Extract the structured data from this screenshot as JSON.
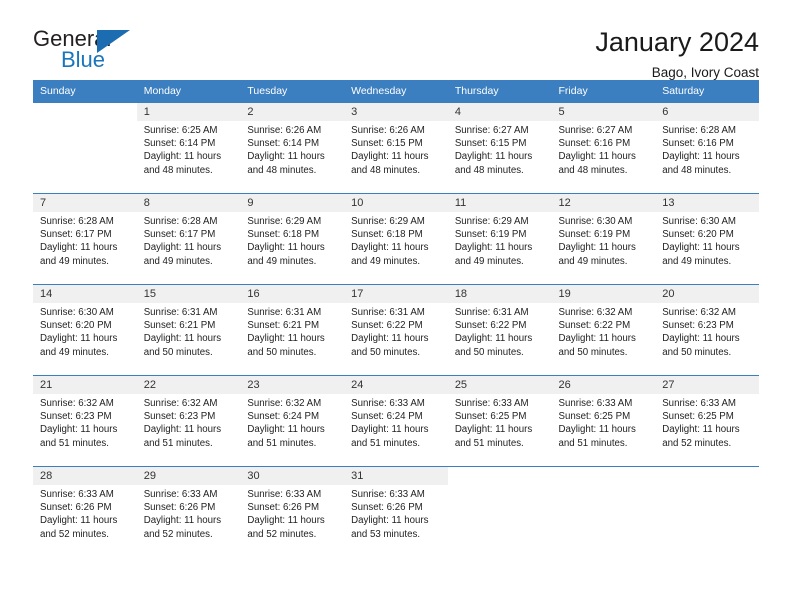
{
  "brand": {
    "name_top": "General",
    "name_bottom": "Blue",
    "accent_color": "#1b75bb",
    "triangle_color": "#1b6cb0"
  },
  "header": {
    "title": "January 2024",
    "subtitle": "Bago, Ivory Coast"
  },
  "calendar": {
    "header_bg": "#3c7fc1",
    "daynum_bg": "#f0f0f0",
    "weekday_headers": [
      "Sunday",
      "Monday",
      "Tuesday",
      "Wednesday",
      "Thursday",
      "Friday",
      "Saturday"
    ],
    "weeks": [
      [
        {
          "day": "",
          "sunrise": "",
          "sunset": "",
          "daylight_line1": "",
          "daylight_line2": ""
        },
        {
          "day": "1",
          "sunrise": "Sunrise: 6:25 AM",
          "sunset": "Sunset: 6:14 PM",
          "daylight_line1": "Daylight: 11 hours",
          "daylight_line2": "and 48 minutes."
        },
        {
          "day": "2",
          "sunrise": "Sunrise: 6:26 AM",
          "sunset": "Sunset: 6:14 PM",
          "daylight_line1": "Daylight: 11 hours",
          "daylight_line2": "and 48 minutes."
        },
        {
          "day": "3",
          "sunrise": "Sunrise: 6:26 AM",
          "sunset": "Sunset: 6:15 PM",
          "daylight_line1": "Daylight: 11 hours",
          "daylight_line2": "and 48 minutes."
        },
        {
          "day": "4",
          "sunrise": "Sunrise: 6:27 AM",
          "sunset": "Sunset: 6:15 PM",
          "daylight_line1": "Daylight: 11 hours",
          "daylight_line2": "and 48 minutes."
        },
        {
          "day": "5",
          "sunrise": "Sunrise: 6:27 AM",
          "sunset": "Sunset: 6:16 PM",
          "daylight_line1": "Daylight: 11 hours",
          "daylight_line2": "and 48 minutes."
        },
        {
          "day": "6",
          "sunrise": "Sunrise: 6:28 AM",
          "sunset": "Sunset: 6:16 PM",
          "daylight_line1": "Daylight: 11 hours",
          "daylight_line2": "and 48 minutes."
        }
      ],
      [
        {
          "day": "7",
          "sunrise": "Sunrise: 6:28 AM",
          "sunset": "Sunset: 6:17 PM",
          "daylight_line1": "Daylight: 11 hours",
          "daylight_line2": "and 49 minutes."
        },
        {
          "day": "8",
          "sunrise": "Sunrise: 6:28 AM",
          "sunset": "Sunset: 6:17 PM",
          "daylight_line1": "Daylight: 11 hours",
          "daylight_line2": "and 49 minutes."
        },
        {
          "day": "9",
          "sunrise": "Sunrise: 6:29 AM",
          "sunset": "Sunset: 6:18 PM",
          "daylight_line1": "Daylight: 11 hours",
          "daylight_line2": "and 49 minutes."
        },
        {
          "day": "10",
          "sunrise": "Sunrise: 6:29 AM",
          "sunset": "Sunset: 6:18 PM",
          "daylight_line1": "Daylight: 11 hours",
          "daylight_line2": "and 49 minutes."
        },
        {
          "day": "11",
          "sunrise": "Sunrise: 6:29 AM",
          "sunset": "Sunset: 6:19 PM",
          "daylight_line1": "Daylight: 11 hours",
          "daylight_line2": "and 49 minutes."
        },
        {
          "day": "12",
          "sunrise": "Sunrise: 6:30 AM",
          "sunset": "Sunset: 6:19 PM",
          "daylight_line1": "Daylight: 11 hours",
          "daylight_line2": "and 49 minutes."
        },
        {
          "day": "13",
          "sunrise": "Sunrise: 6:30 AM",
          "sunset": "Sunset: 6:20 PM",
          "daylight_line1": "Daylight: 11 hours",
          "daylight_line2": "and 49 minutes."
        }
      ],
      [
        {
          "day": "14",
          "sunrise": "Sunrise: 6:30 AM",
          "sunset": "Sunset: 6:20 PM",
          "daylight_line1": "Daylight: 11 hours",
          "daylight_line2": "and 49 minutes."
        },
        {
          "day": "15",
          "sunrise": "Sunrise: 6:31 AM",
          "sunset": "Sunset: 6:21 PM",
          "daylight_line1": "Daylight: 11 hours",
          "daylight_line2": "and 50 minutes."
        },
        {
          "day": "16",
          "sunrise": "Sunrise: 6:31 AM",
          "sunset": "Sunset: 6:21 PM",
          "daylight_line1": "Daylight: 11 hours",
          "daylight_line2": "and 50 minutes."
        },
        {
          "day": "17",
          "sunrise": "Sunrise: 6:31 AM",
          "sunset": "Sunset: 6:22 PM",
          "daylight_line1": "Daylight: 11 hours",
          "daylight_line2": "and 50 minutes."
        },
        {
          "day": "18",
          "sunrise": "Sunrise: 6:31 AM",
          "sunset": "Sunset: 6:22 PM",
          "daylight_line1": "Daylight: 11 hours",
          "daylight_line2": "and 50 minutes."
        },
        {
          "day": "19",
          "sunrise": "Sunrise: 6:32 AM",
          "sunset": "Sunset: 6:22 PM",
          "daylight_line1": "Daylight: 11 hours",
          "daylight_line2": "and 50 minutes."
        },
        {
          "day": "20",
          "sunrise": "Sunrise: 6:32 AM",
          "sunset": "Sunset: 6:23 PM",
          "daylight_line1": "Daylight: 11 hours",
          "daylight_line2": "and 50 minutes."
        }
      ],
      [
        {
          "day": "21",
          "sunrise": "Sunrise: 6:32 AM",
          "sunset": "Sunset: 6:23 PM",
          "daylight_line1": "Daylight: 11 hours",
          "daylight_line2": "and 51 minutes."
        },
        {
          "day": "22",
          "sunrise": "Sunrise: 6:32 AM",
          "sunset": "Sunset: 6:23 PM",
          "daylight_line1": "Daylight: 11 hours",
          "daylight_line2": "and 51 minutes."
        },
        {
          "day": "23",
          "sunrise": "Sunrise: 6:32 AM",
          "sunset": "Sunset: 6:24 PM",
          "daylight_line1": "Daylight: 11 hours",
          "daylight_line2": "and 51 minutes."
        },
        {
          "day": "24",
          "sunrise": "Sunrise: 6:33 AM",
          "sunset": "Sunset: 6:24 PM",
          "daylight_line1": "Daylight: 11 hours",
          "daylight_line2": "and 51 minutes."
        },
        {
          "day": "25",
          "sunrise": "Sunrise: 6:33 AM",
          "sunset": "Sunset: 6:25 PM",
          "daylight_line1": "Daylight: 11 hours",
          "daylight_line2": "and 51 minutes."
        },
        {
          "day": "26",
          "sunrise": "Sunrise: 6:33 AM",
          "sunset": "Sunset: 6:25 PM",
          "daylight_line1": "Daylight: 11 hours",
          "daylight_line2": "and 51 minutes."
        },
        {
          "day": "27",
          "sunrise": "Sunrise: 6:33 AM",
          "sunset": "Sunset: 6:25 PM",
          "daylight_line1": "Daylight: 11 hours",
          "daylight_line2": "and 52 minutes."
        }
      ],
      [
        {
          "day": "28",
          "sunrise": "Sunrise: 6:33 AM",
          "sunset": "Sunset: 6:26 PM",
          "daylight_line1": "Daylight: 11 hours",
          "daylight_line2": "and 52 minutes."
        },
        {
          "day": "29",
          "sunrise": "Sunrise: 6:33 AM",
          "sunset": "Sunset: 6:26 PM",
          "daylight_line1": "Daylight: 11 hours",
          "daylight_line2": "and 52 minutes."
        },
        {
          "day": "30",
          "sunrise": "Sunrise: 6:33 AM",
          "sunset": "Sunset: 6:26 PM",
          "daylight_line1": "Daylight: 11 hours",
          "daylight_line2": "and 52 minutes."
        },
        {
          "day": "31",
          "sunrise": "Sunrise: 6:33 AM",
          "sunset": "Sunset: 6:26 PM",
          "daylight_line1": "Daylight: 11 hours",
          "daylight_line2": "and 53 minutes."
        },
        {
          "day": "",
          "sunrise": "",
          "sunset": "",
          "daylight_line1": "",
          "daylight_line2": ""
        },
        {
          "day": "",
          "sunrise": "",
          "sunset": "",
          "daylight_line1": "",
          "daylight_line2": ""
        },
        {
          "day": "",
          "sunrise": "",
          "sunset": "",
          "daylight_line1": "",
          "daylight_line2": ""
        }
      ]
    ]
  }
}
